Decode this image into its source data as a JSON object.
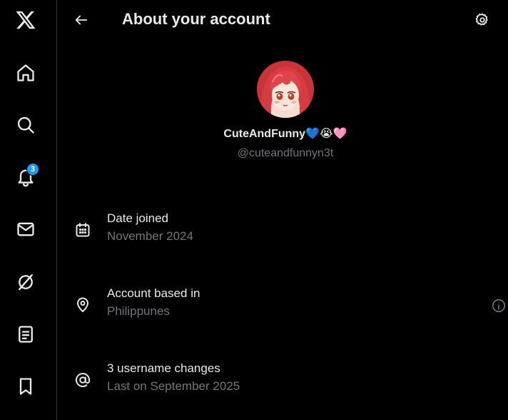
{
  "nav": {
    "notifications_badge": "3",
    "items": [
      {
        "icon": "x-logo-icon"
      },
      {
        "icon": "home-icon"
      },
      {
        "icon": "search-icon"
      },
      {
        "icon": "bell-icon"
      },
      {
        "icon": "mail-icon"
      },
      {
        "icon": "grok-icon"
      },
      {
        "icon": "lists-icon"
      },
      {
        "icon": "bookmark-icon"
      }
    ]
  },
  "header": {
    "title": "About your account",
    "back_icon": "back-arrow-icon",
    "settings_icon": "gear-icon"
  },
  "profile": {
    "display_name": "CuteAndFunny💙😭🩷",
    "handle": "@cuteandfunnyn3t"
  },
  "info": [
    {
      "icon": "calendar-icon",
      "label": "Date joined",
      "value": "November 2024"
    },
    {
      "icon": "location-pin-icon",
      "label": "Account based in",
      "value": "Philippunes",
      "help_icon": "info-circle-icon"
    },
    {
      "icon": "at-sign-icon",
      "label": "3 username changes",
      "value": "Last on September 2025"
    }
  ],
  "colors": {
    "background": "#000000",
    "text_primary": "#e7e9ea",
    "text_secondary": "#71767b",
    "accent": "#1d9bf0",
    "divider": "#2f3336"
  }
}
